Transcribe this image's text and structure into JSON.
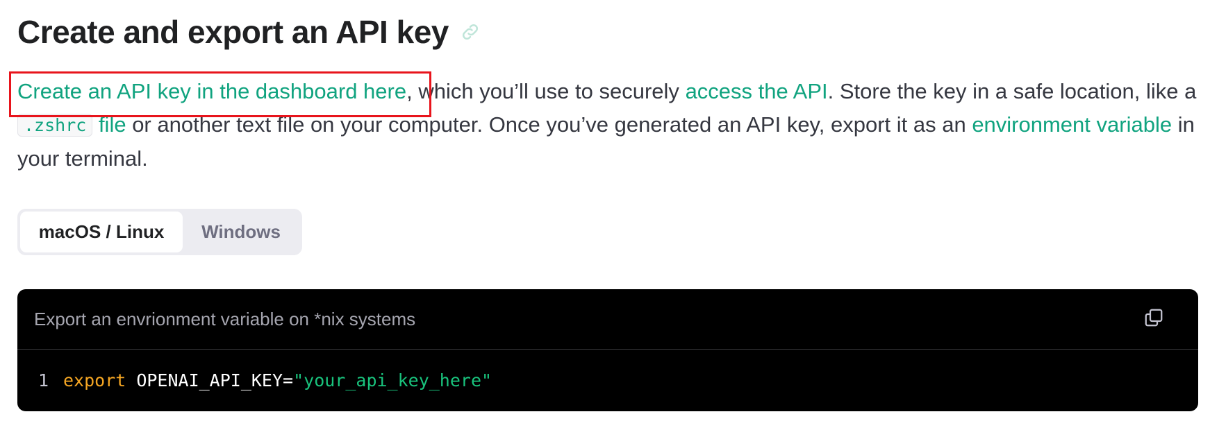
{
  "heading": {
    "title": "Create and export an API key",
    "anchor_icon": "link-icon"
  },
  "intro": {
    "link_dashboard": "Create an API key in the dashboard here",
    "text_1": ", which you’ll use to securely ",
    "link_access": "access the API",
    "text_2": ". Store the key in a safe location, like a ",
    "code_zshrc": ".zshrc",
    "text_3": " ",
    "link_file": "file",
    "text_4": " or another text file on your computer. Once you’ve generated an API key, export it as an ",
    "link_env": "environment variable",
    "text_5": " in your terminal."
  },
  "tabs": [
    {
      "label": "macOS / Linux",
      "active": true
    },
    {
      "label": "Windows",
      "active": false
    }
  ],
  "code_block": {
    "caption": "Export an envrionment variable on *nix systems",
    "copy_icon": "copy-icon",
    "line_number": "1",
    "keyword": "export",
    "variable": "OPENAI_API_KEY=",
    "string": "\"your_api_key_here\""
  },
  "colors": {
    "accent": "#10a37f",
    "highlight": "#e8141c",
    "code_bg": "#000000",
    "keyword": "#f5a623",
    "string": "#19c37d"
  }
}
